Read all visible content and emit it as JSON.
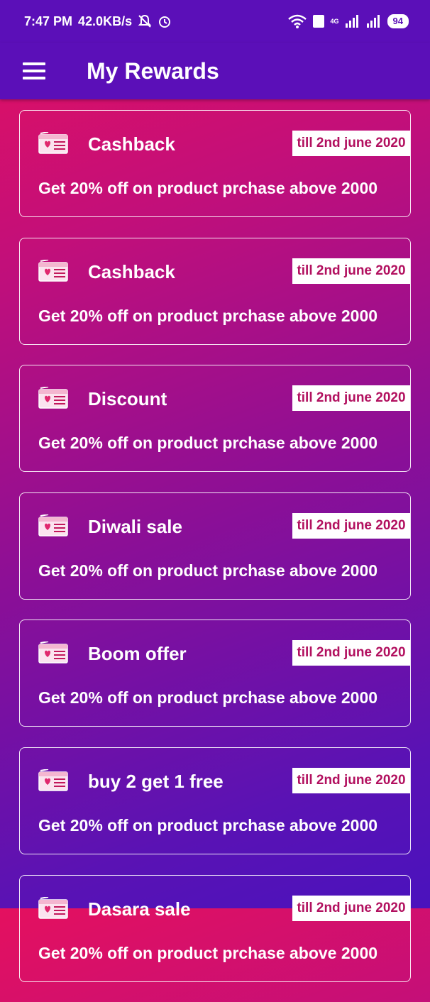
{
  "status_bar": {
    "time": "7:47 PM",
    "speed": "42.0KB/s",
    "network_tag": "4G",
    "battery": "94"
  },
  "header": {
    "title": "My Rewards",
    "menu_icon": "hamburger-menu-icon"
  },
  "colors": {
    "app_bar": "#5b0fb8",
    "date_text": "#b2105f",
    "gradient_top": "#e4105f",
    "gradient_bottom": "#4a12bd"
  },
  "rewards": [
    {
      "title": "Cashback",
      "valid_till": "till 2nd june 2020",
      "description": "Get 20% off on product prchase above 2000"
    },
    {
      "title": "Cashback",
      "valid_till": "till 2nd june 2020",
      "description": "Get 20% off on product prchase above 2000"
    },
    {
      "title": "Discount",
      "valid_till": "till 2nd june 2020",
      "description": "Get 20% off on product prchase above 2000"
    },
    {
      "title": "Diwali sale",
      "valid_till": "till 2nd june 2020",
      "description": "Get 20% off on product prchase above 2000"
    },
    {
      "title": "Boom offer",
      "valid_till": "till 2nd june 2020",
      "description": "Get 20% off on product prchase above 2000"
    },
    {
      "title": "buy 2 get 1 free",
      "valid_till": "till 2nd june 2020",
      "description": "Get 20% off on product prchase above 2000"
    },
    {
      "title": "Dasara sale",
      "valid_till": "till 2nd june 2020",
      "description": "Get 20% off on product prchase above 2000"
    }
  ]
}
